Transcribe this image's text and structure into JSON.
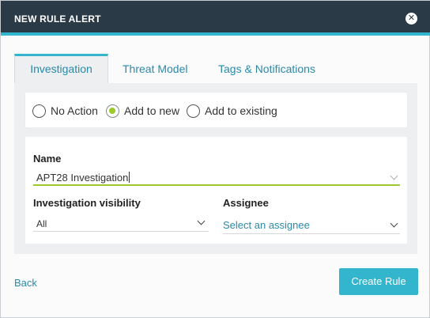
{
  "header": {
    "title": "NEW RULE ALERT",
    "close_glyph": "✕"
  },
  "tabs": [
    {
      "label": "Investigation",
      "active": true
    },
    {
      "label": "Threat Model",
      "active": false
    },
    {
      "label": "Tags & Notifications",
      "active": false
    }
  ],
  "radios": [
    {
      "label": "No Action",
      "selected": false
    },
    {
      "label": "Add to new",
      "selected": true
    },
    {
      "label": "Add to existing",
      "selected": false
    }
  ],
  "form": {
    "name_label": "Name",
    "name_value": "APT28 Investigation",
    "visibility_label": "Investigation visibility",
    "visibility_value": "All",
    "assignee_label": "Assignee",
    "assignee_placeholder": "Select an assignee"
  },
  "footer": {
    "back_label": "Back",
    "create_label": "Create Rule"
  },
  "colors": {
    "header_bg": "#2b3a47",
    "accent": "#33b5ce",
    "link": "#2a89a8",
    "radio_selected": "#9cc92c"
  }
}
